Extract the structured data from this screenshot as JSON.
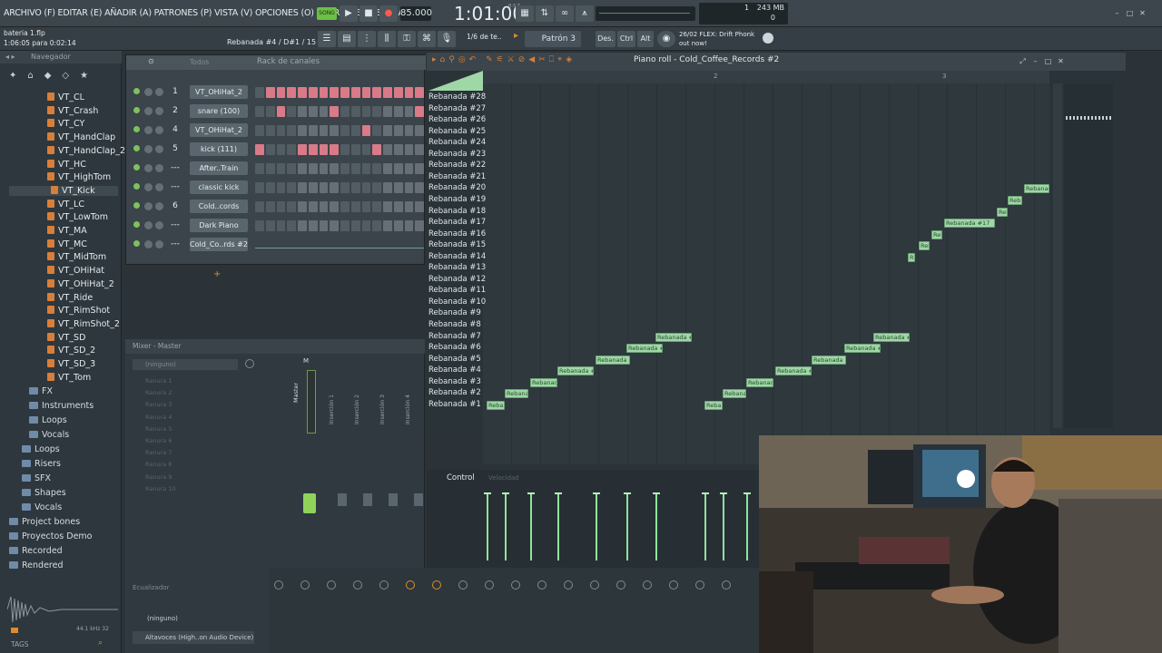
{
  "menubar": {
    "menu_text": "ARCHIVO (F) EDITAR (E) AÑADIR (A) PATRONES (P) VISTA (V) OPCIONES (O) HERRAMIENTAS (T) AYUDA",
    "tempo": "85.000",
    "time": "1:01:00",
    "time_sub": "B:S:T",
    "memory": "243 MB",
    "cpu_top": "1",
    "cpu_bottom": "0",
    "song_label": "SONG"
  },
  "hintbar": {
    "file": "bateria 1.flp",
    "progress": "1:06:05 para 0:02:14",
    "hint": "Rebanada #4 / D#1 / 15",
    "snap": "1/6 de te..",
    "pattern": "Patrón 3",
    "btn_des": "Des.",
    "btn_ctrl": "Ctrl",
    "btn_alt": "Alt",
    "news_date": "26/02",
    "news_text": "FLEX: Drift Phonk",
    "news_sub": "out now!"
  },
  "browser": {
    "title": "Navegador",
    "items": [
      "VT_CL",
      "VT_Crash",
      "VT_CY",
      "VT_HandClap",
      "VT_HandClap_2",
      "VT_HC",
      "VT_HighTom",
      "VT_Kick",
      "VT_LC",
      "VT_LowTom",
      "VT_MA",
      "VT_MC",
      "VT_MidTom",
      "VT_OHiHat",
      "VT_OHiHat_2",
      "VT_Ride",
      "VT_RimShot",
      "VT_RimShot_2",
      "VT_SD",
      "VT_SD_2",
      "VT_SD_3",
      "VT_Tom"
    ],
    "selected": "VT_Kick",
    "folders": [
      "FX",
      "Instruments",
      "Loops",
      "Vocals",
      "Loops",
      "Risers",
      "SFX",
      "Shapes",
      "Vocals",
      "Project bones",
      "Proyectos Demo",
      "Recorded",
      "Rendered"
    ],
    "tags_label": "TAGS",
    "sample_info": "44.1 kHz 32"
  },
  "rack": {
    "title": "Rack de canales",
    "filter": "Todos",
    "channels": [
      {
        "num": "1",
        "name": "VT_OHiHat_2"
      },
      {
        "num": "2",
        "name": "snare (100)"
      },
      {
        "num": "4",
        "name": "VT_OHiHat_2"
      },
      {
        "num": "5",
        "name": "kick (111)"
      },
      {
        "num": "---",
        "name": "After..Train"
      },
      {
        "num": "---",
        "name": "classic kick"
      },
      {
        "num": "6",
        "name": "Cold..cords"
      },
      {
        "num": "---",
        "name": "Dark Piano"
      },
      {
        "num": "---",
        "name": "Cold_Co..rds #2"
      }
    ]
  },
  "mixer": {
    "title": "Mixer - Master",
    "preset": "(ninguno)",
    "slots": [
      "Ranura 1",
      "Ranura 2",
      "Ranura 3",
      "Ranura 4",
      "Ranura 5",
      "Ranura 6",
      "Ranura 7",
      "Ranura 8",
      "Ranura 9",
      "Ranura 10"
    ],
    "eq_label": "Ecualizador",
    "output_preset": "(ninguno)",
    "output_device": "Altavoces (High..on Audio Device)",
    "strips": [
      "Master",
      "Inserción 1",
      "Inserción 2",
      "Inserción 3",
      "Inserción 4"
    ],
    "master_letter": "M"
  },
  "piano_roll": {
    "title": "Piano roll - Cold_Coffee_Records #2",
    "bar_markers": [
      "2",
      "3"
    ],
    "keys": [
      "Rebanada #28",
      "Rebanada #27",
      "Rebanada #26",
      "Rebanada #25",
      "Rebanada #24",
      "Rebanada #23",
      "Rebanada #22",
      "Rebanada #21",
      "Rebanada #20",
      "Rebanada #19",
      "Rebanada #18",
      "Rebanada #17",
      "Rebanada #16",
      "Rebanada #15",
      "Rebanada #14",
      "Rebanada #13",
      "Rebanada #12",
      "Rebanada #11",
      "Rebanada #10",
      "Rebanada #9",
      "Rebanada #8",
      "Rebanada #7",
      "Rebanada #6",
      "Rebanada #5",
      "Rebanada #4",
      "Rebanada #3",
      "Rebanada #2",
      "Rebanada #1"
    ],
    "notes": [
      {
        "label": "Reba..",
        "row": 1
      },
      {
        "label": "Rebanad..",
        "row": 2
      },
      {
        "label": "Rebanada..",
        "row": 3
      },
      {
        "label": "Rebanada #4",
        "row": 4
      },
      {
        "label": "Rebanada #5",
        "row": 5
      },
      {
        "label": "Rebanada #6",
        "row": 6
      },
      {
        "label": "Rebanada #7",
        "row": 7
      },
      {
        "label": "Reba..",
        "row": 1
      },
      {
        "label": "Rebanad..",
        "row": 2
      },
      {
        "label": "Rebanada..",
        "row": 3
      },
      {
        "label": "Rebanada #4",
        "row": 4
      },
      {
        "label": "Rebanada #5",
        "row": 5
      },
      {
        "label": "Rebanada #6",
        "row": 6
      },
      {
        "label": "Rebanada #7",
        "row": 7
      },
      {
        "label": "R..",
        "row": 14
      },
      {
        "label": "Reb..",
        "row": 15
      },
      {
        "label": "Reb..",
        "row": 16
      },
      {
        "label": "Rebanada #17",
        "row": 17
      },
      {
        "label": "Reb..",
        "row": 18
      },
      {
        "label": "Reb..",
        "row": 19
      },
      {
        "label": "Rebanada",
        "row": 20
      }
    ],
    "control_label": "Control",
    "control_sub": "Velocidad"
  },
  "colors": {
    "note": "#9fd7a6",
    "accent_orange": "#e08a2c",
    "record": "#d83a3a",
    "step_on": "#d97a88"
  }
}
